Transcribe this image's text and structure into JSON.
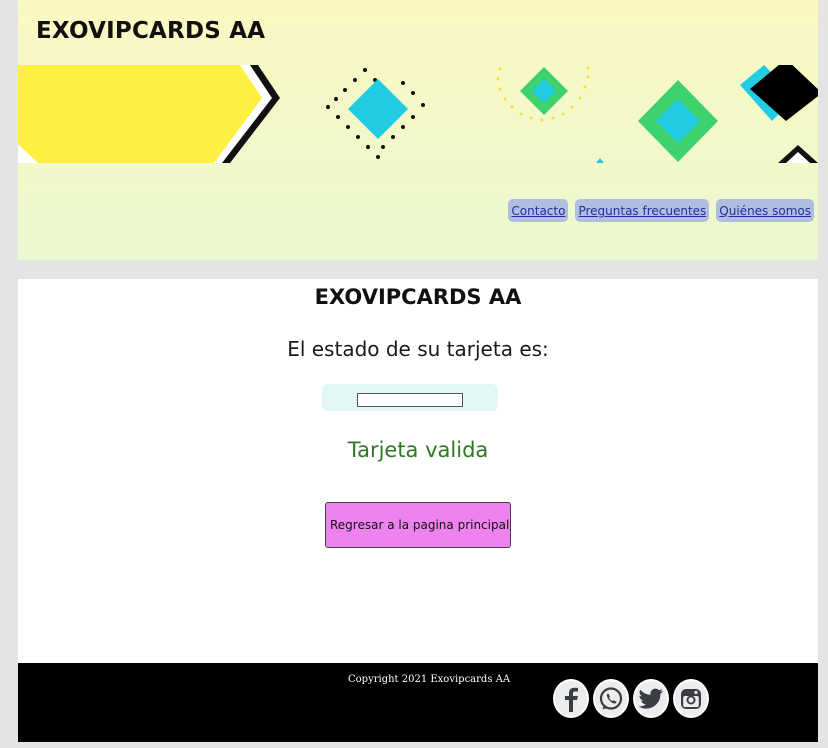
{
  "header": {
    "site_title": "EXOVIPCARDS AA",
    "nav": [
      {
        "label": "Contacto"
      },
      {
        "label": "Preguntas frecuentes"
      },
      {
        "label": "Quiénes somos"
      }
    ]
  },
  "main": {
    "title": "EXOVIPCARDS AA",
    "status_label": "El estado de su tarjeta es:",
    "card_input_value": "",
    "status_result": "Tarjeta valida",
    "back_button_label": "Regresar a la pagina principal"
  },
  "footer": {
    "copyright": "Copyright 2021 Exovipcards AA",
    "social_icons": [
      "facebook-icon",
      "whatsapp-icon",
      "twitter-icon",
      "instagram-icon"
    ]
  },
  "colors": {
    "header_gradient_top": "#fbf8c2",
    "header_gradient_bottom": "#ecf8d0",
    "nav_bg": "#b0bfe0",
    "button_bg": "#ee82ee",
    "valid_text": "#2c7a1e",
    "footer_bg": "#000000"
  }
}
